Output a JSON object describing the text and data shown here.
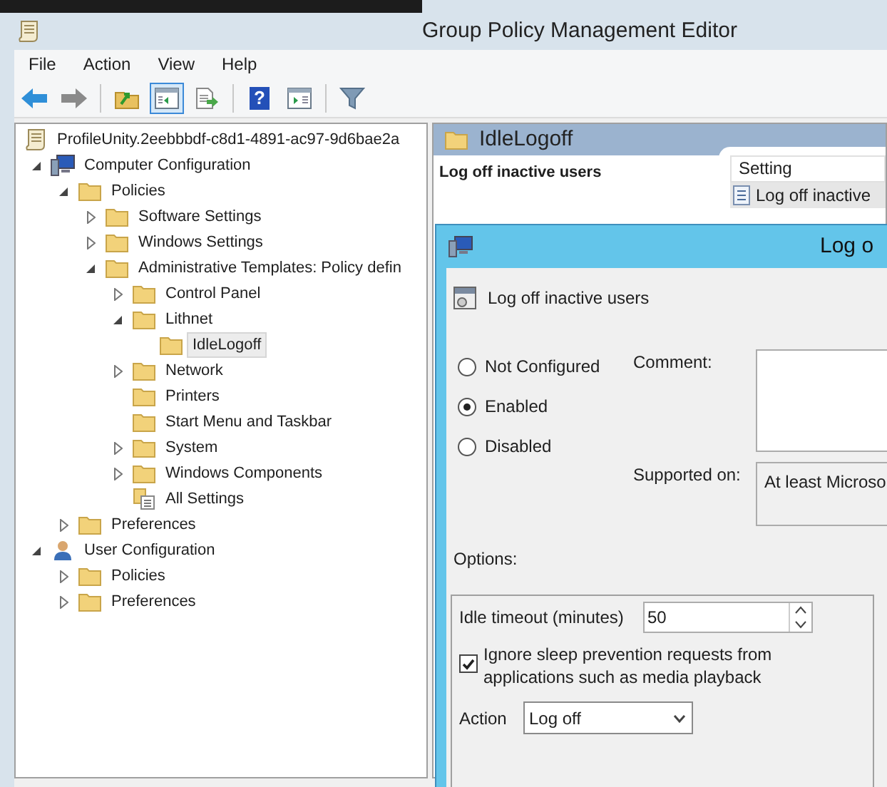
{
  "window": {
    "title": "Group Policy Management Editor"
  },
  "menu": [
    "File",
    "Action",
    "View",
    "Help"
  ],
  "toolbar": [
    {
      "kind": "back",
      "selected": false
    },
    {
      "kind": "forward",
      "selected": false
    },
    {
      "kind": "sep"
    },
    {
      "kind": "up",
      "selected": false
    },
    {
      "kind": "tree",
      "selected": true
    },
    {
      "kind": "export",
      "selected": false
    },
    {
      "kind": "sep"
    },
    {
      "kind": "help",
      "glyph": "?",
      "selected": false
    },
    {
      "kind": "pane",
      "selected": false
    },
    {
      "kind": "sep"
    },
    {
      "kind": "filter",
      "selected": false
    }
  ],
  "tree": [
    {
      "label": "ProfileUnity.2eebbbdf-c8d1-4891-ac97-9d6bae2a",
      "kind": "policy",
      "selected": false,
      "children": [
        {
          "label": "Computer Configuration",
          "kind": "computer",
          "expanded": true,
          "selected": false,
          "children": [
            {
              "label": "Policies",
              "kind": "folder",
              "expanded": true,
              "selected": false,
              "children": [
                {
                  "label": "Software Settings",
                  "kind": "folder",
                  "expanded": false,
                  "selected": false
                },
                {
                  "label": "Windows Settings",
                  "kind": "folder",
                  "expanded": false,
                  "selected": false
                },
                {
                  "label": "Administrative Templates: Policy defin",
                  "kind": "folder",
                  "expanded": true,
                  "selected": false,
                  "children": [
                    {
                      "label": "Control Panel",
                      "kind": "folder",
                      "expanded": false,
                      "selected": false
                    },
                    {
                      "label": "Lithnet",
                      "kind": "folder",
                      "expanded": true,
                      "selected": false,
                      "children": [
                        {
                          "label": "IdleLogoff",
                          "kind": "folder",
                          "selected": true
                        }
                      ]
                    },
                    {
                      "label": "Network",
                      "kind": "folder",
                      "expanded": false,
                      "selected": false
                    },
                    {
                      "label": "Printers",
                      "kind": "folder",
                      "selected": false
                    },
                    {
                      "label": "Start Menu and Taskbar",
                      "kind": "folder",
                      "selected": false
                    },
                    {
                      "label": "System",
                      "kind": "folder",
                      "expanded": false,
                      "selected": false
                    },
                    {
                      "label": "Windows Components",
                      "kind": "folder",
                      "expanded": false,
                      "selected": false
                    },
                    {
                      "label": "All Settings",
                      "kind": "settings",
                      "selected": false
                    }
                  ]
                }
              ]
            },
            {
              "label": "Preferences",
              "kind": "folder",
              "expanded": false,
              "selected": false
            }
          ]
        },
        {
          "label": "User Configuration",
          "kind": "user",
          "expanded": true,
          "selected": false,
          "children": [
            {
              "label": "Policies",
              "kind": "folder",
              "expanded": false,
              "selected": false
            },
            {
              "label": "Preferences",
              "kind": "folder",
              "expanded": false,
              "selected": false
            }
          ]
        }
      ]
    }
  ],
  "details": {
    "header": "IdleLogoff",
    "setting_title": "Log off inactive users",
    "column": "Setting",
    "rows": [
      {
        "label": "Log off inactive",
        "selected": true
      }
    ]
  },
  "dialog": {
    "title": "Log o",
    "policy_name": "Log off inactive users",
    "states": [
      {
        "label": "Not Configured",
        "selected": false
      },
      {
        "label": "Enabled",
        "selected": true
      },
      {
        "label": "Disabled",
        "selected": false
      }
    ],
    "comment_label": "Comment:",
    "supported_label": "Supported on:",
    "supported_value": "At least Microso",
    "options_label": "Options:",
    "timeout_label": "Idle timeout (minutes)",
    "timeout_value": "50",
    "ignore_sleep": {
      "label": "Ignore sleep prevention requests from applications such as media playback",
      "checked": true
    },
    "action_label": "Action",
    "action_value": "Log off"
  }
}
